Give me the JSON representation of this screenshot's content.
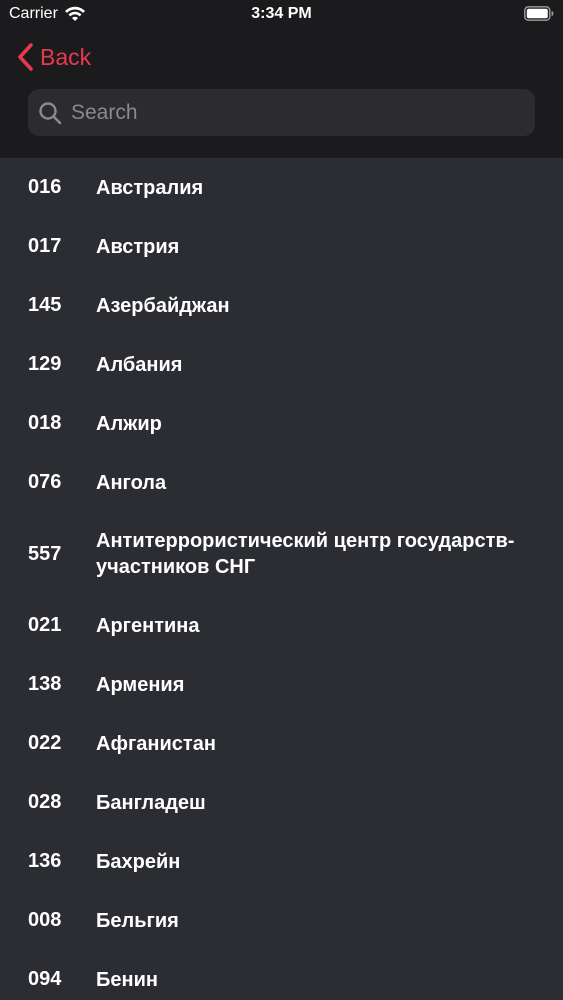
{
  "status_bar": {
    "carrier": "Carrier",
    "time": "3:34 PM"
  },
  "nav": {
    "back_label": "Back"
  },
  "search": {
    "placeholder": "Search"
  },
  "colors": {
    "accent": "#e8384f",
    "header_bg": "#1b1b1d",
    "list_bg": "#2b2d33"
  },
  "items": [
    {
      "code": "016",
      "name": "Австралия"
    },
    {
      "code": "017",
      "name": "Австрия"
    },
    {
      "code": "145",
      "name": "Азербайджан"
    },
    {
      "code": "129",
      "name": "Албания"
    },
    {
      "code": "018",
      "name": "Алжир"
    },
    {
      "code": "076",
      "name": "Ангола"
    },
    {
      "code": "557",
      "name": "Антитеррористический центр государств-участников СНГ"
    },
    {
      "code": "021",
      "name": "Аргентина"
    },
    {
      "code": "138",
      "name": "Армения"
    },
    {
      "code": "022",
      "name": "Афганистан"
    },
    {
      "code": "028",
      "name": "Бангладеш"
    },
    {
      "code": "136",
      "name": "Бахрейн"
    },
    {
      "code": "008",
      "name": "Бельгия"
    },
    {
      "code": "094",
      "name": "Бенин"
    }
  ]
}
